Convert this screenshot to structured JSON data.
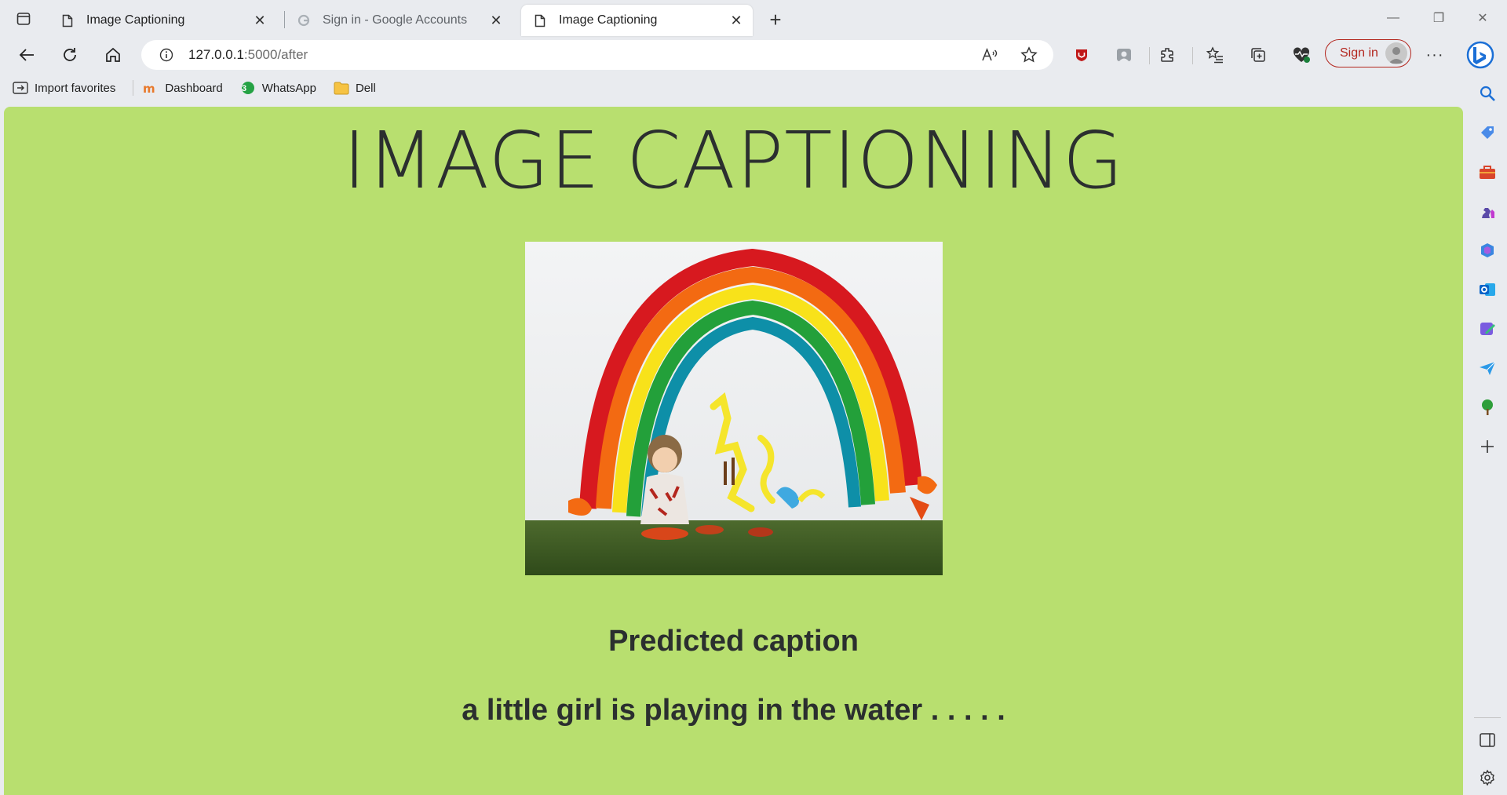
{
  "tabs": [
    {
      "title": "Image Captioning",
      "close": "✕"
    },
    {
      "title": "Sign in - Google Accounts",
      "close": "✕"
    },
    {
      "title": "Image Captioning",
      "close": "✕"
    }
  ],
  "newtab": "+",
  "window": {
    "minimize": "—",
    "restore": "❐",
    "close": "✕"
  },
  "address": {
    "host": "127.0.0.1",
    "path": ":5000/after"
  },
  "profile": {
    "signin_label": "Sign in"
  },
  "more": "···",
  "favorites": [
    {
      "label": "Import favorites"
    },
    {
      "label": "Dashboard"
    },
    {
      "label": "WhatsApp",
      "badge": "3"
    },
    {
      "label": "Dell"
    }
  ],
  "page": {
    "title": "IMAGE CAPTIONING",
    "caption_heading": "Predicted caption",
    "caption": "a little girl is playing in the water . . . . ."
  },
  "colors": {
    "page_bg": "#b8df6f",
    "text": "#2b2f2f",
    "signin": "#b3261e"
  }
}
